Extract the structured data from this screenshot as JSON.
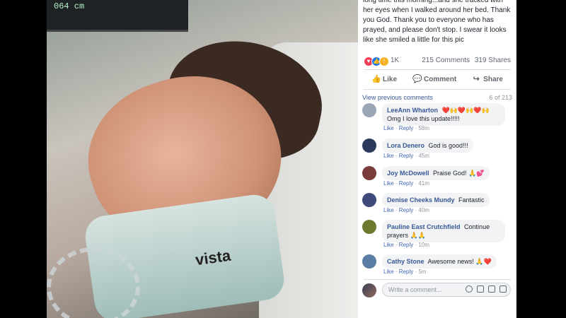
{
  "photo": {
    "monitor_text": "064 cm",
    "collar_text": "vista"
  },
  "post": {
    "text": "long time this morning...and she tracked with her eyes when I walked around her bed. Thank you God. Thank you to everyone who has prayed, and please don't stop. I swear it looks like she smiled a little for this pic"
  },
  "reactions": {
    "count": "1K",
    "comments": "215 Comments",
    "shares": "319 Shares"
  },
  "actions": {
    "like": "Like",
    "comment": "Comment",
    "share": "Share"
  },
  "comments_header": {
    "view_previous": "View previous comments",
    "pager": "6 of 213"
  },
  "comments": [
    {
      "name": "LeeAnn Wharton",
      "text": "Omg I love this update!!!!!",
      "emojis": "❤️🙌❤️🙌❤️🙌",
      "time": "58m",
      "avatar_color": "#9aa7b5"
    },
    {
      "name": "Lora Denero",
      "text": "God is good!!!",
      "emojis": "",
      "time": "45m",
      "avatar_color": "#2b3a5c"
    },
    {
      "name": "Joy McDowell",
      "text": "Praise God!",
      "emojis": "🙏💕",
      "time": "41m",
      "avatar_color": "#7a3b3b"
    },
    {
      "name": "Denise Cheeks Mundy",
      "text": "Fantastic",
      "emojis": "",
      "time": "40m",
      "avatar_color": "#3d4a7a"
    },
    {
      "name": "Pauline East Crutchfield",
      "text": "Continue prayers",
      "emojis": "🙏🙏",
      "time": "10m",
      "avatar_color": "#6b7a2e"
    },
    {
      "name": "Cathy Stone",
      "text": "Awesome news!",
      "emojis": "🙏❤️",
      "time": "5m",
      "avatar_color": "#5a7da3"
    }
  ],
  "comment_actions": {
    "like": "Like",
    "reply": "Reply"
  },
  "write": {
    "placeholder": "Write a comment..."
  }
}
